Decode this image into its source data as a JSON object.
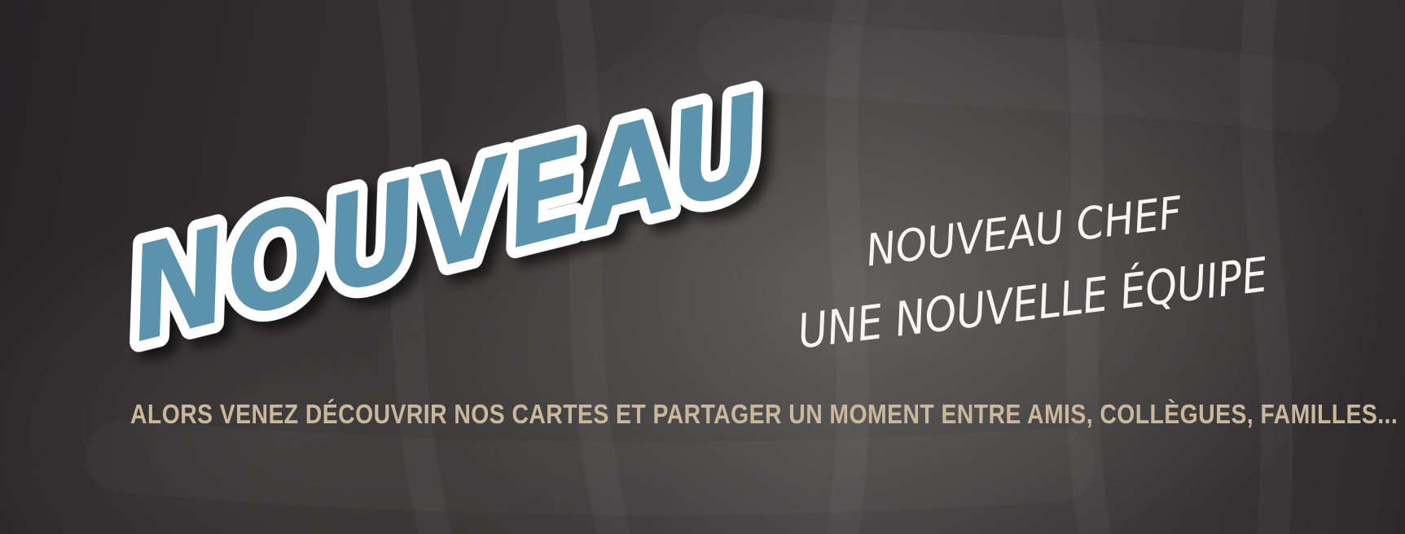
{
  "banner": {
    "hero_word": "NOUVEAU",
    "tagline_line1": "NOUVEAU CHEF",
    "tagline_line2": "UNE NOUVELLE ÉQUIPE",
    "invite_text": "Alors venez découvrir nos cartes et partager un moment entre amis, collègues, familles...",
    "colors": {
      "background": "#353333",
      "hero_fill": "#5a93ab",
      "hero_outline": "#ffffff",
      "tagline": "#f7f5f1",
      "invite": "#cbb79c"
    }
  }
}
